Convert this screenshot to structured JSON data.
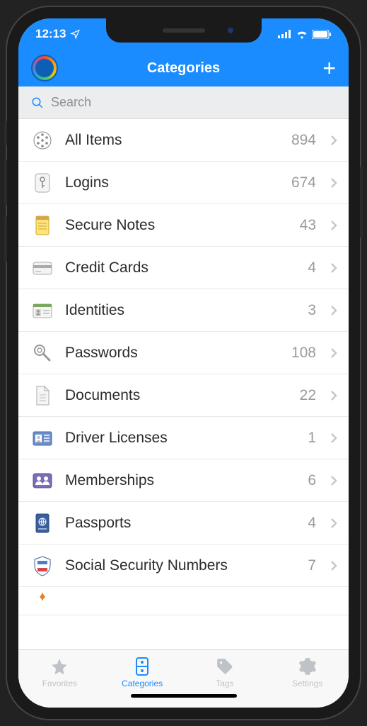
{
  "statusBar": {
    "time": "12:13"
  },
  "header": {
    "title": "Categories"
  },
  "search": {
    "placeholder": "Search"
  },
  "categories": [
    {
      "key": "all",
      "label": "All Items",
      "count": 894
    },
    {
      "key": "logins",
      "label": "Logins",
      "count": 674
    },
    {
      "key": "notes",
      "label": "Secure Notes",
      "count": 43
    },
    {
      "key": "cards",
      "label": "Credit Cards",
      "count": 4
    },
    {
      "key": "identities",
      "label": "Identities",
      "count": 3
    },
    {
      "key": "passwords",
      "label": "Passwords",
      "count": 108
    },
    {
      "key": "documents",
      "label": "Documents",
      "count": 22
    },
    {
      "key": "driverlic",
      "label": "Driver Licenses",
      "count": 1
    },
    {
      "key": "memberships",
      "label": "Memberships",
      "count": 6
    },
    {
      "key": "passports",
      "label": "Passports",
      "count": 4
    },
    {
      "key": "ssn",
      "label": "Social Security Numbers",
      "count": 7
    }
  ],
  "tabs": {
    "favorites": "Favorites",
    "categories": "Categories",
    "tags": "Tags",
    "settings": "Settings"
  }
}
